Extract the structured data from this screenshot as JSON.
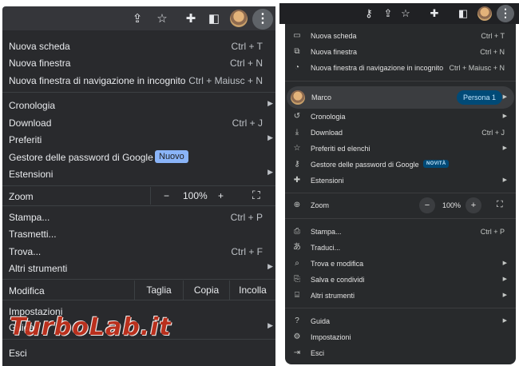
{
  "left": {
    "toolbar_icons": [
      "share-icon",
      "star-icon",
      "extensions-icon",
      "side-panel-icon",
      "avatar",
      "more-vert-icon"
    ],
    "kebab_glyph": "⋮",
    "items": [
      {
        "label": "Nuova scheda",
        "shortcut": "Ctrl + T"
      },
      {
        "label": "Nuova finestra",
        "shortcut": "Ctrl + N"
      },
      {
        "label": "Nuova finestra di navigazione in incognito",
        "shortcut": "Ctrl + Maiusc + N"
      },
      {
        "label": "Cronologia",
        "submenu": true
      },
      {
        "label": "Download",
        "shortcut": "Ctrl + J"
      },
      {
        "label": "Preferiti",
        "submenu": true
      },
      {
        "label": "Gestore delle password di Google",
        "badge": "Nuovo"
      },
      {
        "label": "Estensioni",
        "submenu": true
      },
      {
        "label": "Stampa...",
        "shortcut": "Ctrl + P"
      },
      {
        "label": "Trasmetti..."
      },
      {
        "label": "Trova...",
        "shortcut": "Ctrl + F"
      },
      {
        "label": "Altri strumenti",
        "submenu": true
      },
      {
        "label": "Impostazioni"
      },
      {
        "label": "Guida",
        "submenu": true
      },
      {
        "label": "Esci"
      }
    ],
    "zoom": {
      "label": "Zoom",
      "minus": "−",
      "value": "100%",
      "plus": "+",
      "fullscreen": "⛶"
    },
    "edit": {
      "label": "Modifica",
      "cut": "Taglia",
      "copy": "Copia",
      "paste": "Incolla"
    },
    "watermark": "TurboLab.it"
  },
  "right": {
    "toolbar_icons": [
      "key-icon",
      "share-icon",
      "star-icon",
      "extensions-icon",
      "side-panel-icon",
      "avatar",
      "more-vert-icon"
    ],
    "kebab_glyph": "⋮",
    "items": [
      {
        "label": "Nuova scheda",
        "shortcut": "Ctrl + T",
        "icon": "new-tab-icon"
      },
      {
        "label": "Nuova finestra",
        "shortcut": "Ctrl + N",
        "icon": "new-window-icon"
      },
      {
        "label": "Nuova finestra di navigazione in incognito",
        "shortcut": "Ctrl + Maiusc + N",
        "icon": "incognito-icon"
      },
      {
        "label": "Cronologia",
        "submenu": true,
        "icon": "history-icon"
      },
      {
        "label": "Download",
        "shortcut": "Ctrl + J",
        "icon": "download-icon"
      },
      {
        "label": "Preferiti ed elenchi",
        "submenu": true,
        "icon": "star-icon"
      },
      {
        "label": "Gestore delle password di Google",
        "badge": "NOVITÀ",
        "icon": "key-icon"
      },
      {
        "label": "Estensioni",
        "submenu": true,
        "icon": "extensions-icon"
      },
      {
        "label": "Stampa...",
        "shortcut": "Ctrl + P",
        "icon": "print-icon"
      },
      {
        "label": "Traduci...",
        "icon": "translate-icon"
      },
      {
        "label": "Trova e modifica",
        "submenu": true,
        "icon": "find-icon"
      },
      {
        "label": "Salva e condividi",
        "submenu": true,
        "icon": "save-share-icon"
      },
      {
        "label": "Altri strumenti",
        "submenu": true,
        "icon": "toolbox-icon"
      },
      {
        "label": "Guida",
        "submenu": true,
        "icon": "help-icon"
      },
      {
        "label": "Impostazioni",
        "icon": "settings-icon"
      },
      {
        "label": "Esci",
        "icon": "exit-icon"
      }
    ],
    "profile": {
      "name": "Marco",
      "badge": "Persona 1"
    },
    "zoom": {
      "label": "Zoom",
      "minus": "−",
      "value": "100%",
      "plus": "+",
      "fullscreen": "⛶"
    }
  },
  "colors": {
    "left_menu_bg": "#292a2d",
    "right_menu_bg": "#282a2c",
    "badge_blue": "#8ab4f8",
    "persona_pill": "#004a77",
    "watermark_red": "#c6311c"
  }
}
